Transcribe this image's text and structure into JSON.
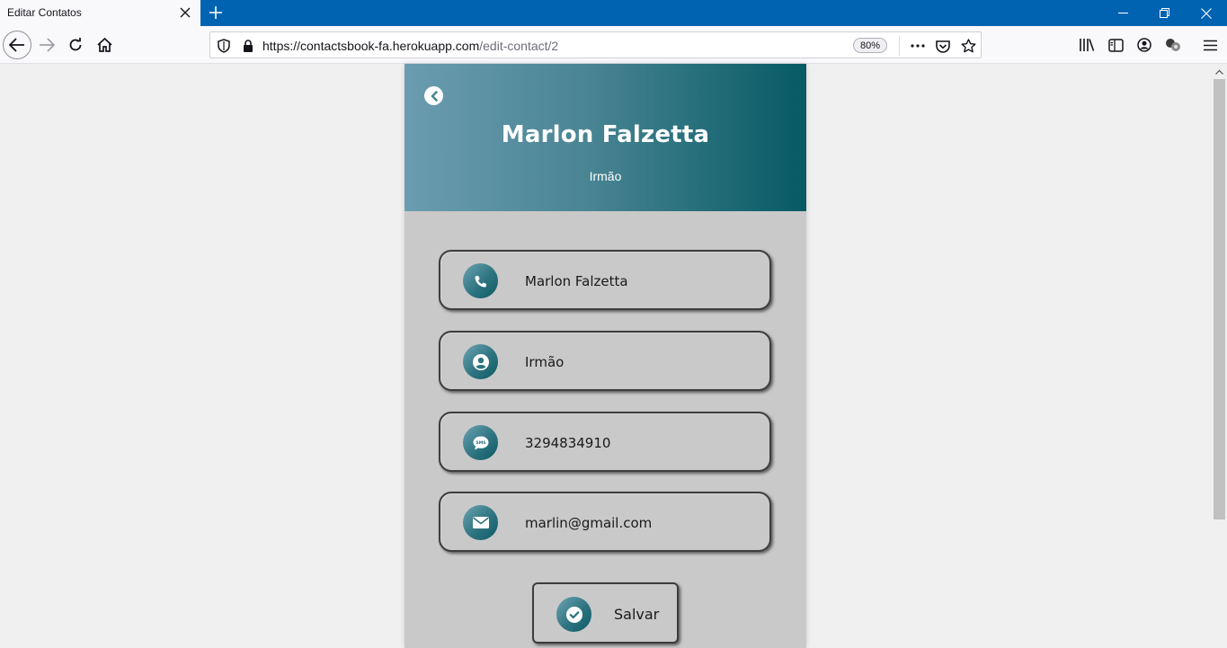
{
  "browser": {
    "tab_title": "Editar Contatos",
    "url_host": "https://contactsbook-fa.herokuapp.com",
    "url_path": "/edit-contact/2",
    "zoom": "80%"
  },
  "header": {
    "name": "Marlon Falzetta",
    "relation": "Irmão"
  },
  "fields": [
    {
      "icon": "phone-icon",
      "value": "Marlon Falzetta"
    },
    {
      "icon": "user-icon",
      "value": "Irmão"
    },
    {
      "icon": "sms-icon",
      "value": "3294834910"
    },
    {
      "icon": "mail-icon",
      "value": "marlin@gmail.com"
    }
  ],
  "save_button": {
    "label": "Salvar",
    "icon": "check-icon"
  },
  "colors": {
    "tabbar": "#0063b1",
    "header_gradient_start": "#6b9cb0",
    "header_gradient_end": "#055a64",
    "card_bg": "#c9c9c9",
    "page_bg": "#f0f0f0"
  }
}
